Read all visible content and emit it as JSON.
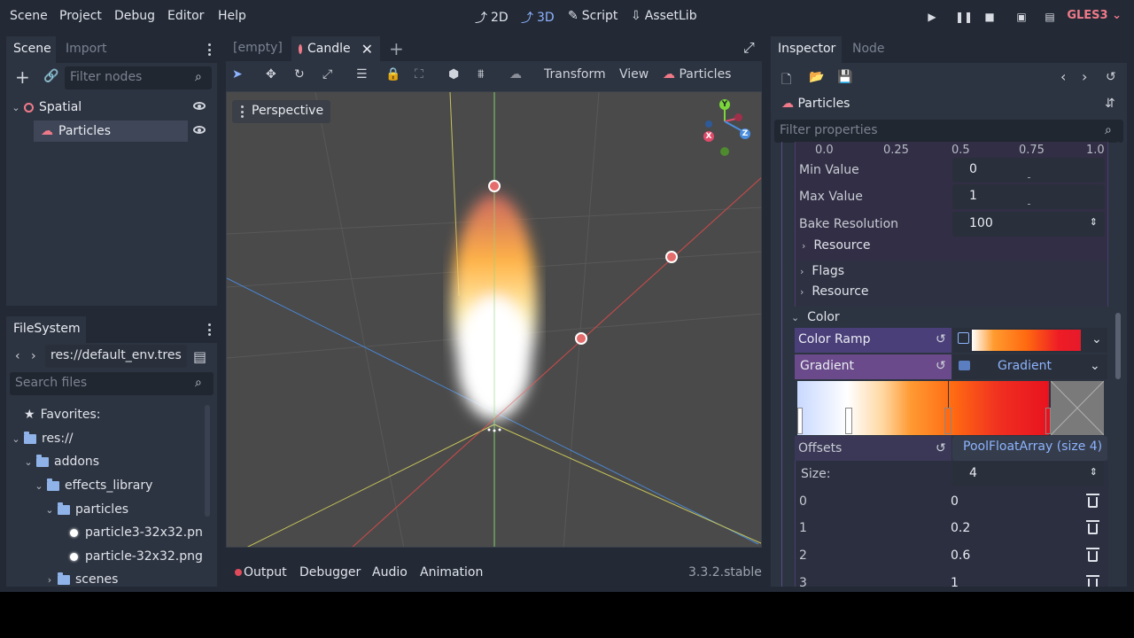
{
  "menu": {
    "items": [
      "Scene",
      "Project",
      "Debug",
      "Editor",
      "Help"
    ],
    "workspaces": [
      {
        "label": "2D",
        "icon": "2d-icon"
      },
      {
        "label": "3D",
        "icon": "3d-icon",
        "active": true
      },
      {
        "label": "Script",
        "icon": "script-icon"
      },
      {
        "label": "AssetLib",
        "icon": "assetlib-icon"
      }
    ],
    "renderer": "GLES3",
    "renderer_color": "#f07a89"
  },
  "scene_dock": {
    "tabs": [
      "Scene",
      "Import"
    ],
    "filter_placeholder": "Filter nodes",
    "nodes": [
      {
        "label": "Spatial",
        "icon": "spatial-icon"
      },
      {
        "label": "Particles",
        "icon": "particles-icon",
        "selected": true
      }
    ]
  },
  "filesystem": {
    "tab": "FileSystem",
    "path": "res://default_env.tres",
    "search_placeholder": "Search files",
    "items": [
      {
        "label": "Favorites:",
        "icon": "star-icon"
      },
      {
        "label": "res://",
        "icon": "folder-icon"
      },
      {
        "label": "addons",
        "icon": "folder-icon"
      },
      {
        "label": "effects_library",
        "icon": "folder-icon"
      },
      {
        "label": "particles",
        "icon": "folder-icon"
      },
      {
        "label": "particle3-32x32.pn",
        "icon": "image-icon"
      },
      {
        "label": "particle-32x32.png",
        "icon": "image-icon"
      },
      {
        "label": "scenes",
        "icon": "folder-icon"
      }
    ]
  },
  "editor_tabs": {
    "tabs": [
      "[empty]",
      "Candle"
    ],
    "active": "Candle"
  },
  "viewport": {
    "toolbar_menus": [
      "Transform",
      "View",
      "Particles"
    ],
    "perspective_label": "Perspective",
    "background": "#4a4a4a",
    "gizmo_axes": [
      "Y",
      "X",
      "Z"
    ]
  },
  "bottom_panel": {
    "tabs": [
      "Output",
      "Debugger",
      "Audio",
      "Animation"
    ],
    "version": "3.3.2.stable"
  },
  "inspector": {
    "tabs": [
      "Inspector",
      "Node"
    ],
    "node_name": "Particles",
    "filter_placeholder": "Filter properties",
    "curve_ticks": [
      "0.0",
      "0.25",
      "0.5",
      "0.75",
      "1.0"
    ],
    "min_value_label": "Min Value",
    "min_value": "0",
    "max_value_label": "Max Value",
    "max_value": "1",
    "bake_resolution_label": "Bake Resolution",
    "bake_resolution": "100",
    "resource_label": "Resource",
    "flags_label": "Flags",
    "resource2_label": "Resource",
    "color_section": "Color",
    "color_ramp_label": "Color Ramp",
    "gradient_label": "Gradient",
    "gradient_value": "Gradient",
    "offsets_label": "Offsets",
    "offsets_value": "PoolFloatArray (size 4)",
    "size_label": "Size:",
    "size_value": "4",
    "array_items": [
      {
        "index": "0",
        "value": "0"
      },
      {
        "index": "1",
        "value": "0.2"
      },
      {
        "index": "2",
        "value": "0.6"
      },
      {
        "index": "3",
        "value": "1"
      }
    ],
    "accent_color": "#8db4ff"
  }
}
